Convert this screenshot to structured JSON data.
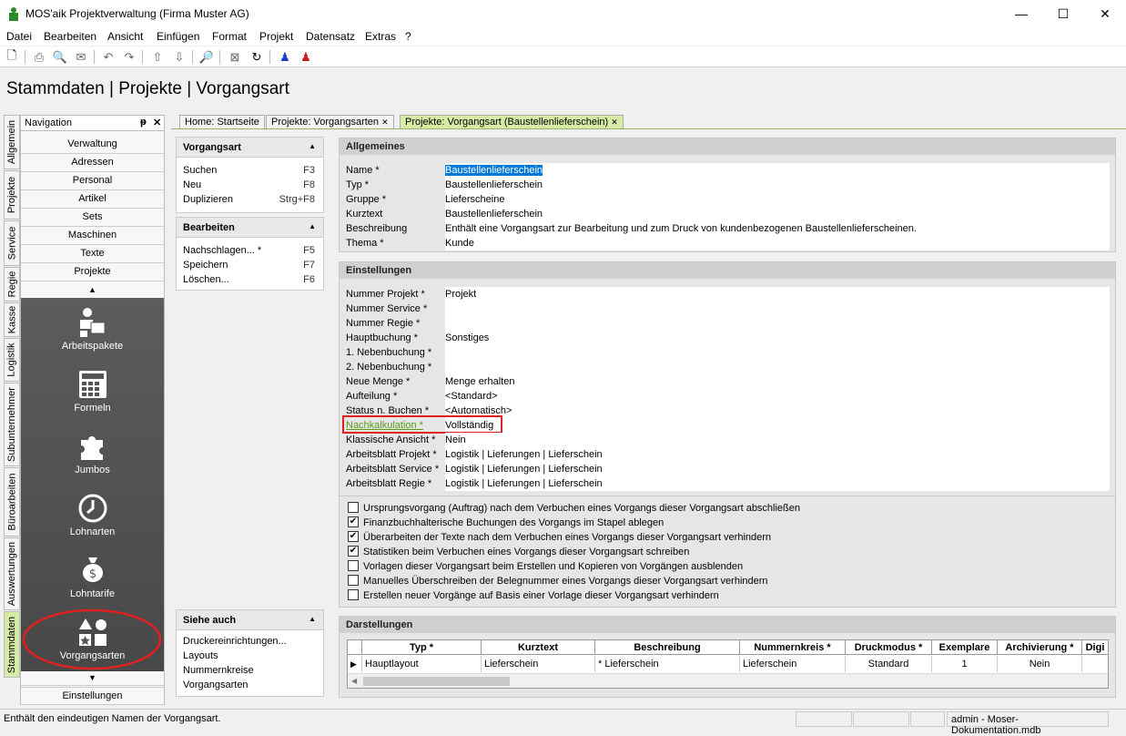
{
  "window": {
    "title": "MOS'aik Projektverwaltung (Firma Muster AG)",
    "min": "—",
    "max": "☐",
    "close": "✕"
  },
  "menu": [
    "Datei",
    "Bearbeiten",
    "Ansicht",
    "Einfügen",
    "Format",
    "Projekt",
    "Datensatz",
    "Extras",
    "?"
  ],
  "breadcrumb": "Stammdaten | Projekte | Vorgangsart",
  "vtabs": [
    "Allgemein",
    "Projekte",
    "Service",
    "Regie",
    "Kasse",
    "Logistik",
    "Subunternehmer",
    "Büroarbeiten",
    "Auswertungen",
    "Stammdaten"
  ],
  "nav": {
    "title": "Navigation",
    "pin": "ᵽ",
    "close": "✕",
    "buttons": [
      "Verwaltung",
      "Adressen",
      "Personal",
      "Artikel",
      "Sets",
      "Maschinen",
      "Texte",
      "Projekte"
    ],
    "up": "▲",
    "down": "▼",
    "items": [
      "Arbeitspakete",
      "Formeln",
      "Jumbos",
      "Lohnarten",
      "Lohntarife",
      "Vorgangsarten"
    ],
    "bottom": "Einstellungen"
  },
  "tabs": [
    {
      "label": "Home: Startseite"
    },
    {
      "label": "Projekte: Vorgangsarten",
      "close": "✕"
    },
    {
      "label": "Projekte: Vorgangsart (Baustellenlieferschein)",
      "close": "✕"
    }
  ],
  "panels": {
    "vorgangsart": {
      "title": "Vorgangsart",
      "rows": [
        {
          "label": "Suchen",
          "key": "F3"
        },
        {
          "label": "Neu",
          "key": "F8"
        },
        {
          "label": "Duplizieren",
          "key": "Strg+F8"
        }
      ]
    },
    "bearbeiten": {
      "title": "Bearbeiten",
      "rows": [
        {
          "label": "Nachschlagen... *",
          "key": "F5"
        },
        {
          "label": "Speichern",
          "key": "F7"
        },
        {
          "label": "Löschen...",
          "key": "F6"
        }
      ]
    },
    "siehe": {
      "title": "Siehe auch",
      "rows": [
        {
          "label": "Druckereinrichtungen..."
        },
        {
          "label": "Layouts"
        },
        {
          "label": "Nummernkreise"
        },
        {
          "label": "Vorgangsarten"
        }
      ]
    }
  },
  "allgemeines": {
    "title": "Allgemeines",
    "fields": [
      {
        "label": "Name *",
        "value": "Baustellenlieferschein"
      },
      {
        "label": "Typ *",
        "value": "Baustellenlieferschein"
      },
      {
        "label": "Gruppe *",
        "value": "Lieferscheine"
      },
      {
        "label": "Kurztext",
        "value": "Baustellenlieferschein"
      },
      {
        "label": "Beschreibung",
        "value": "Enthält eine Vorgangsart zur Bearbeitung und zum Druck von kundenbezogenen Baustellenlieferscheinen."
      },
      {
        "label": "Thema *",
        "value": "Kunde"
      }
    ]
  },
  "einstellungen": {
    "title": "Einstellungen",
    "fields": [
      {
        "label": "Nummer Projekt *",
        "value": "Projekt"
      },
      {
        "label": "Nummer Service *",
        "value": ""
      },
      {
        "label": "Nummer Regie *",
        "value": ""
      },
      {
        "label": "Hauptbuchung *",
        "value": "Sonstiges"
      },
      {
        "label": "1. Nebenbuchung *",
        "value": ""
      },
      {
        "label": "2. Nebenbuchung *",
        "value": ""
      },
      {
        "label": "Neue Menge *",
        "value": "Menge erhalten"
      },
      {
        "label": "Aufteilung *",
        "value": "<Standard>"
      },
      {
        "label": "Status n. Buchen *",
        "value": "<Automatisch>"
      },
      {
        "label": "Nachkalkulation *",
        "value": "Vollständig"
      },
      {
        "label": "Klassische Ansicht *",
        "value": "Nein"
      },
      {
        "label": "Arbeitsblatt Projekt *",
        "value": "Logistik | Lieferungen | Lieferschein"
      },
      {
        "label": "Arbeitsblatt Service *",
        "value": "Logistik | Lieferungen | Lieferschein"
      },
      {
        "label": "Arbeitsblatt Regie *",
        "value": "Logistik | Lieferungen | Lieferschein"
      }
    ]
  },
  "checkboxes": [
    {
      "label": "Ursprungsvorgang (Auftrag) nach dem Verbuchen eines Vorgangs dieser Vorgangsart abschließen",
      "mark": ""
    },
    {
      "label": "Finanzbuchhalterische Buchungen des Vorgangs im Stapel ablegen",
      "mark": "✔"
    },
    {
      "label": "Überarbeiten der Texte nach dem Verbuchen eines Vorgangs dieser Vorgangsart verhindern",
      "mark": "✔"
    },
    {
      "label": "Statistiken beim Verbuchen eines Vorgangs dieser Vorgangsart schreiben",
      "mark": "✔"
    },
    {
      "label": "Vorlagen dieser Vorgangsart beim Erstellen und Kopieren von Vorgängen ausblenden",
      "mark": ""
    },
    {
      "label": "Manuelles Überschreiben der Belegnummer eines Vorgangs dieser Vorgangsart verhindern",
      "mark": ""
    },
    {
      "label": "Erstellen neuer Vorgänge auf Basis einer Vorlage dieser Vorgangsart verhindern",
      "mark": ""
    }
  ],
  "darstellungen": {
    "title": "Darstellungen",
    "columns": [
      "Typ *",
      "Kurztext",
      "Beschreibung",
      "Nummernkreis *",
      "Druckmodus *",
      "Exemplare",
      "Archivierung *",
      "Digi"
    ],
    "row": {
      "marker": "▶",
      "cells": [
        "Hauptlayout",
        "Lieferschein",
        "* Lieferschein",
        "Lieferschein",
        "Standard",
        "1",
        "Nein",
        ""
      ]
    },
    "scroll_left": "◀"
  },
  "status": {
    "text": "Enthält den eindeutigen Namen der Vorgangsart.",
    "db": "admin - Moser-Dokumentation.mdb"
  },
  "colors": {
    "accent": "#d6eba6",
    "highlight": "#0078d7",
    "link": "#5a9b17",
    "annotation": "#e02020"
  }
}
